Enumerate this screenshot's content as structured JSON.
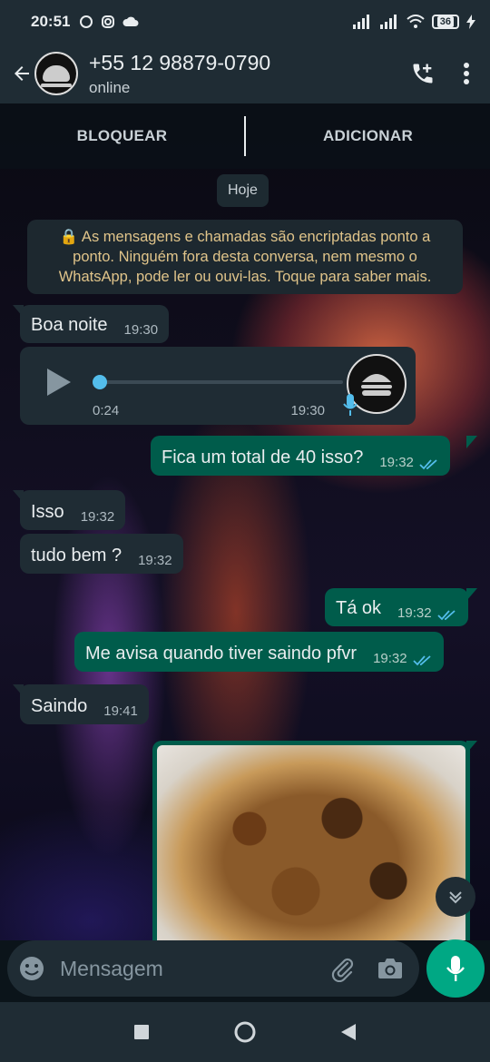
{
  "status_bar": {
    "time": "20:51",
    "battery": "36"
  },
  "header": {
    "contact_name": "+55 12 98879-0790",
    "status": "online"
  },
  "action_bar": {
    "block_label": "BLOQUEAR",
    "add_label": "ADICIONAR"
  },
  "day_label": "Hoje",
  "encryption_notice": "🔒 As mensagens e chamadas são encriptadas ponto a ponto. Ninguém fora desta conversa, nem mesmo o WhatsApp, pode ler ou ouvi-las. Toque para saber mais.",
  "messages": [
    {
      "direction": "in",
      "text": "Boa noite",
      "time": "19:30"
    },
    {
      "direction": "in",
      "type": "voice",
      "duration": "0:24",
      "time": "19:30",
      "progress": 0.0
    },
    {
      "direction": "out",
      "text": "Fica um total de 40 isso?",
      "time": "19:32",
      "read": true
    },
    {
      "direction": "in",
      "text": "Isso",
      "time": "19:32"
    },
    {
      "direction": "in",
      "text": "tudo bem ?",
      "time": "19:32"
    },
    {
      "direction": "out",
      "text": "Tá ok",
      "time": "19:32",
      "read": true
    },
    {
      "direction": "out",
      "text": "Me avisa quando tiver saindo pfvr",
      "time": "19:32",
      "read": true
    },
    {
      "direction": "in",
      "text": "Saindo",
      "time": "19:41"
    },
    {
      "direction": "out",
      "type": "image"
    }
  ],
  "composer": {
    "placeholder": "Mensagem"
  },
  "colors": {
    "incoming": "#1f2c34",
    "outgoing": "#005c4b",
    "accent": "#00a884",
    "read_ticks": "#53bdeb"
  },
  "icons": [
    "back-arrow-icon",
    "add-call-icon",
    "more-vert-icon",
    "play-icon",
    "mic-icon",
    "emoji-icon",
    "attach-icon",
    "camera-icon",
    "chevron-down-icon"
  ]
}
